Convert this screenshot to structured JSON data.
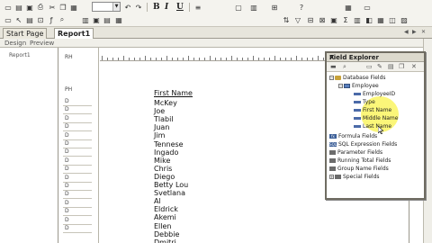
{
  "toolbar": {
    "row1_icons": [
      "new-icon",
      "open-icon",
      "save-icon",
      "print-icon",
      "cut-icon",
      "copy-icon",
      "paste-icon",
      "format-painter-icon",
      "undo-icon",
      "redo-icon"
    ],
    "row1_right_icons": [
      "insert-icon",
      "chart-icon",
      "export-icon",
      "help-icon"
    ],
    "bold": "B",
    "italic": "I",
    "underline": "U",
    "row2_icons": [
      "text-object-icon",
      "arrow-icon",
      "group-icon",
      "formula-icon",
      "zoom-icon",
      "layout-icon",
      "field-icon",
      "section-icon"
    ]
  },
  "tabs": {
    "start_page": "Start Page",
    "report": "Report1"
  },
  "view": {
    "design": "Design",
    "preview": "Preview"
  },
  "group_tree": {
    "root": "Report1"
  },
  "sections": {
    "rh": "RH",
    "ph": "PH",
    "details": [
      "D",
      "D",
      "D",
      "D",
      "D",
      "D",
      "D",
      "D",
      "D",
      "D",
      "D",
      "D",
      "D",
      "D",
      "D",
      "D"
    ]
  },
  "report": {
    "column_header": "First Name",
    "names": [
      "McKey",
      "Joe",
      "Tlabil",
      "Juan",
      "Jim",
      "Tennese",
      "Ingado",
      "Mike",
      "Chris",
      "Diego",
      "Betty Lou",
      "Svetlana",
      "Al",
      "Eldrick",
      "Akemi",
      "Ellen",
      "Debbie",
      "Dmitri"
    ]
  },
  "field_explorer": {
    "title": "Field Explorer",
    "close": "X",
    "tools": [
      "insert-to-report-icon",
      "browse-icon",
      "new-icon",
      "edit-icon",
      "rename-icon",
      "delete-icon"
    ],
    "tree": {
      "database_fields": "Database Fields",
      "table": "Employee",
      "fields": [
        "EmployeeID",
        "Type",
        "First Name",
        "Middle Name",
        "Last Name"
      ],
      "formula_fields": "Formula Fields",
      "sql_expression_fields": "SQL Expression Fields",
      "parameter_fields": "Parameter Fields",
      "running_total_fields": "Running Total Fields",
      "group_name_fields": "Group Name Fields",
      "special_fields": "Special Fields"
    }
  },
  "colors": {
    "highlight": "#fbf56a",
    "toolbar_bg": "#f4f3ee",
    "panel_border": "#6f6c62"
  }
}
